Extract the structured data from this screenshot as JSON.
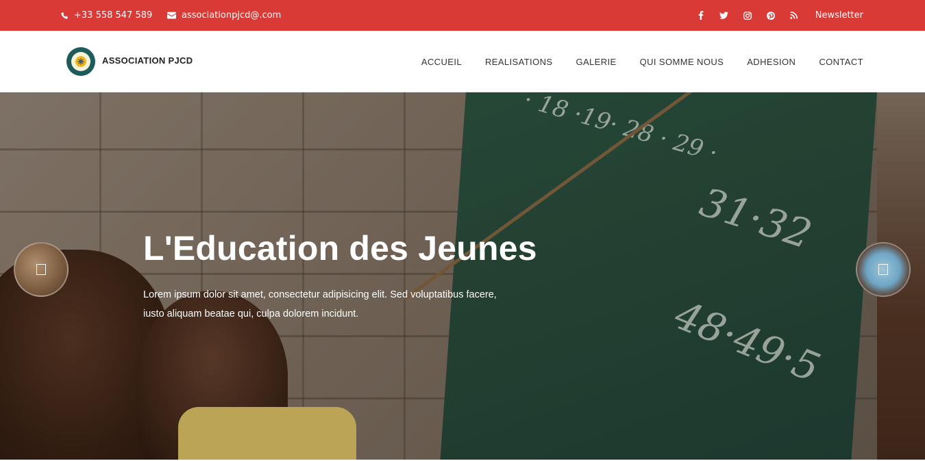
{
  "topbar": {
    "phone": "+33 558 547 589",
    "email": "associationpjcd@.com",
    "newsletter": "Newsletter",
    "socials": [
      "facebook-icon",
      "twitter-icon",
      "instagram-icon",
      "pinterest-icon",
      "rss-icon"
    ],
    "color": "#d93a36"
  },
  "header": {
    "brand": "ASSOCIATION PJCD",
    "nav": [
      "ACCUEIL",
      "REALISATIONS",
      "GALERIE",
      "QUI SOMME NOUS",
      "ADHESION",
      "CONTACT"
    ]
  },
  "hero": {
    "title": "L'Education des Jeunes",
    "text": "Lorem ipsum dolor sit amet, consectetur adipisicing elit. Sed voluptatibus facere, iusto aliquam beatae qui, culpa dolorem incidunt."
  }
}
